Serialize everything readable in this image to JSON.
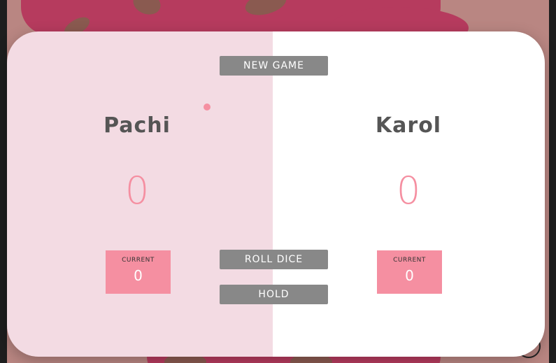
{
  "players": [
    {
      "name": "Pachi",
      "score": "0",
      "current_label": "CURRENT",
      "current_score": "0",
      "active": true
    },
    {
      "name": "Karol",
      "score": "0",
      "current_label": "CURRENT",
      "current_score": "0",
      "active": false
    }
  ],
  "controls": {
    "new_game": "NEW GAME",
    "roll_dice": "ROLL DICE",
    "hold": "HOLD"
  },
  "colors": {
    "accent": "#f58fa1",
    "active_panel": "#f3dbe3",
    "inactive_panel": "#ffffff",
    "button": "#888888",
    "background": "#b63b5e"
  }
}
